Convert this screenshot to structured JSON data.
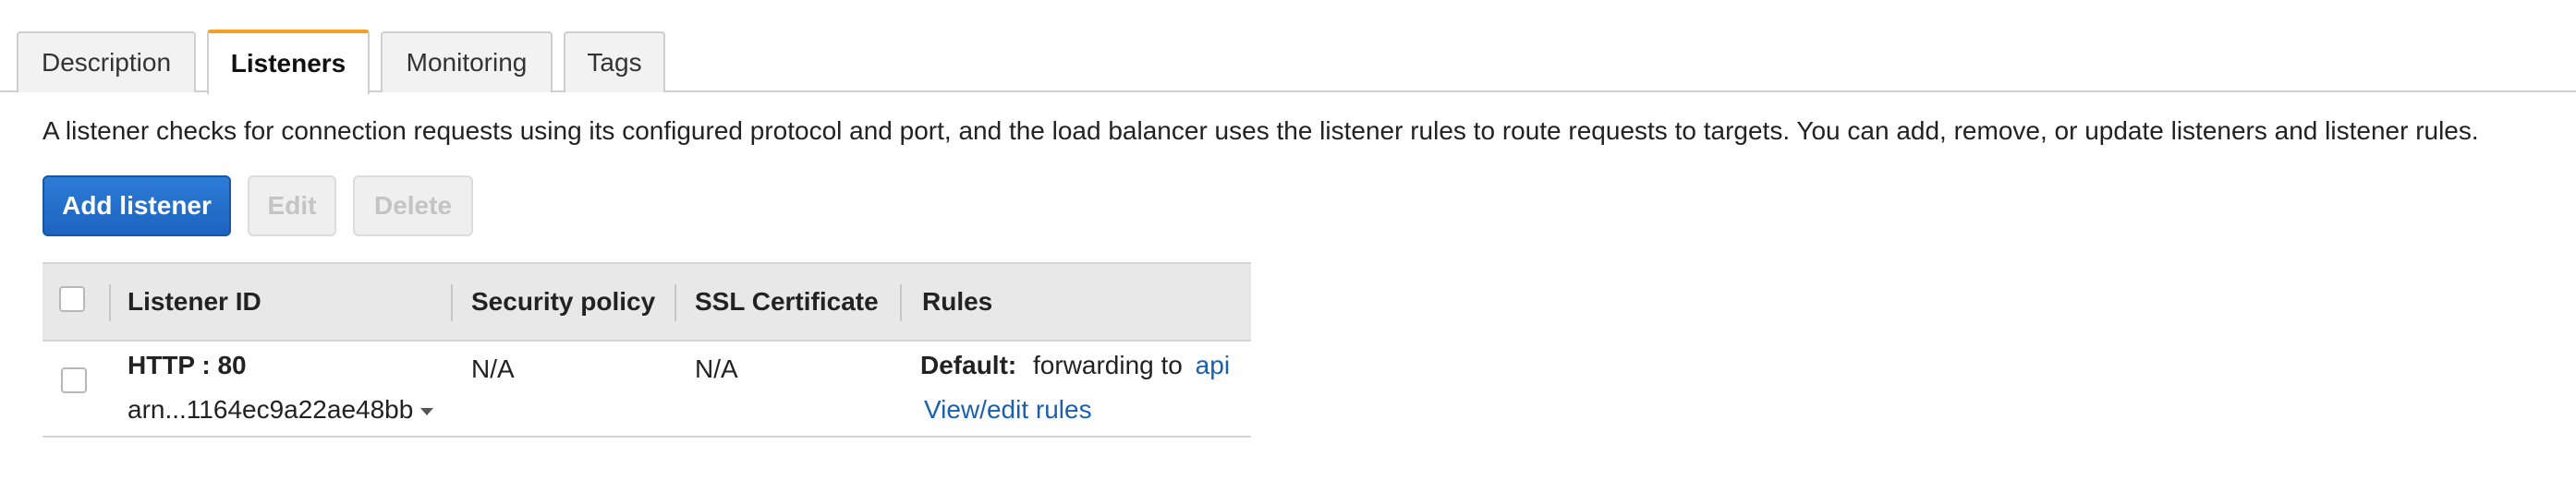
{
  "tabs": [
    {
      "label": "Description",
      "active": false
    },
    {
      "label": "Listeners",
      "active": true
    },
    {
      "label": "Monitoring",
      "active": false
    },
    {
      "label": "Tags",
      "active": false
    }
  ],
  "description": "A listener checks for connection requests using its configured protocol and port, and the load balancer uses the listener rules to route requests to targets. You can add, remove, or update listeners and listener rules.",
  "actions": {
    "add_label": "Add listener",
    "edit_label": "Edit",
    "delete_label": "Delete"
  },
  "table": {
    "headers": {
      "listener_id": "Listener ID",
      "security_policy": "Security policy",
      "ssl_certificate": "SSL Certificate",
      "rules": "Rules"
    },
    "rows": [
      {
        "protocol_port": "HTTP : 80",
        "arn": "arn...1164ec9a22ae48bb",
        "security_policy": "N/A",
        "ssl_certificate": "N/A",
        "rules_default_label": "Default:",
        "rules_default_text": "forwarding to",
        "rules_target": "api",
        "view_edit_rules": "View/edit rules"
      }
    ]
  },
  "colors": {
    "active_tab_accent": "#f59f25",
    "primary_button": "#1d63c0",
    "link": "#1a5fb4"
  }
}
